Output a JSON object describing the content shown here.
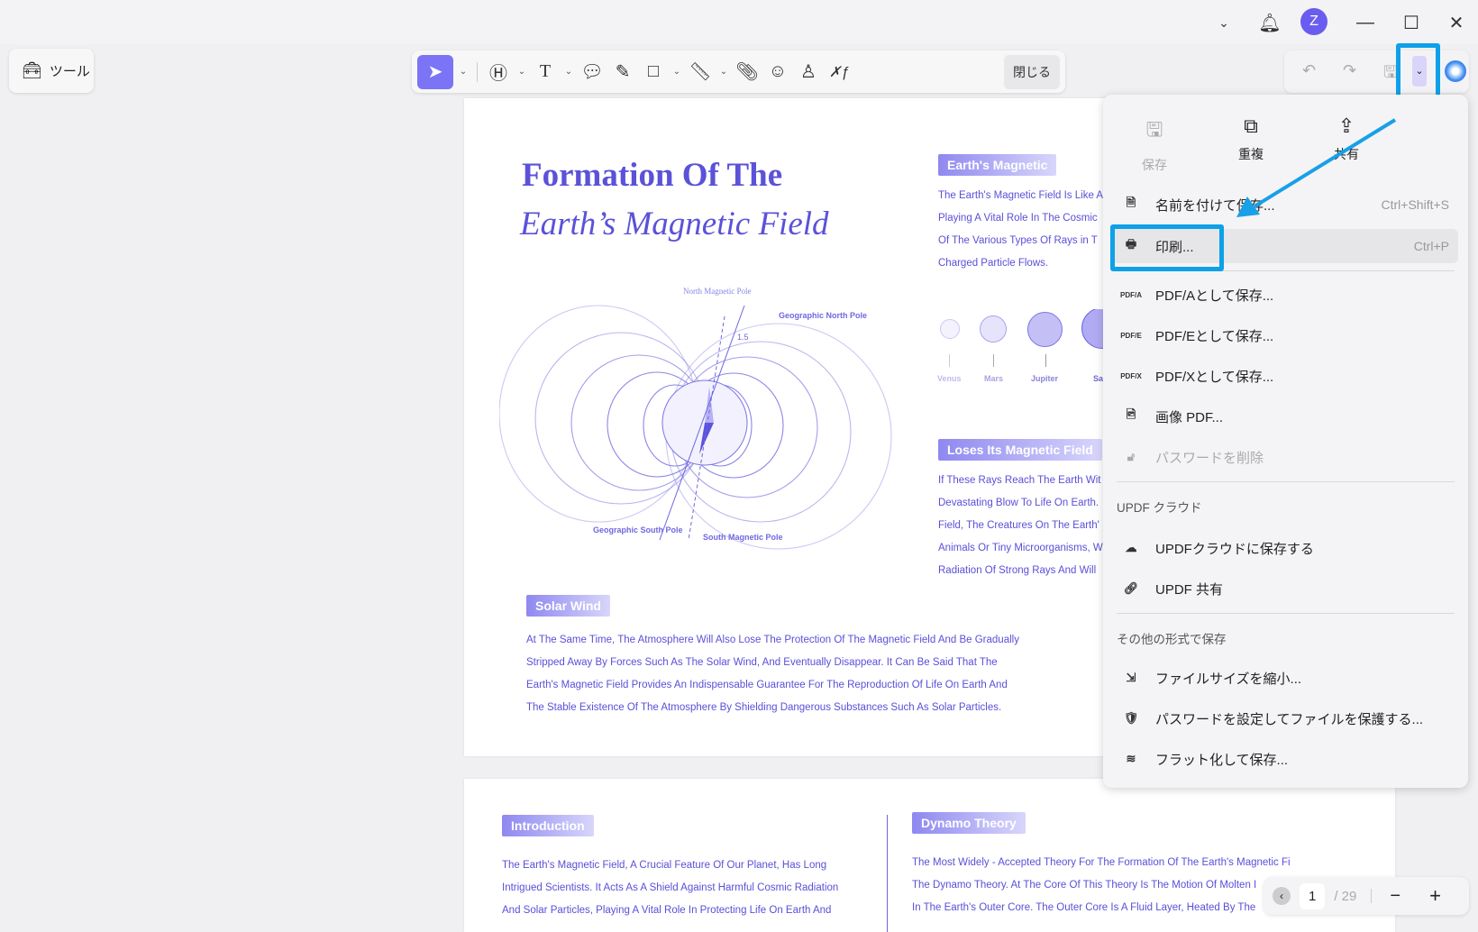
{
  "titlebar": {
    "avatar": "Z"
  },
  "tools_button": {
    "label": "ツール"
  },
  "toolbar": {
    "close_label": "閉じる"
  },
  "page1": {
    "title_line1": "Formation Of The",
    "title_line2": "Earth’s Magnetic Field",
    "diagram": {
      "north_magnetic": "North Magnetic Pole",
      "geo_north": "Geographic North Pole",
      "angle": "1.5",
      "geo_south": "Geographic South Pole",
      "south_magnetic": "South Magnetic Pole"
    },
    "earths_magnetic": {
      "heading": "Earth's Magnetic",
      "lines": [
        "The Earth's Magnetic Field Is Like A",
        "Playing A Vital Role In The Cosmic",
        "Of The Various Types Of Rays in T",
        "Charged Particle Flows."
      ]
    },
    "planets": [
      "Venus",
      "Mars",
      "Jupiter",
      "Sa"
    ],
    "loses": {
      "heading": "Loses Its Magnetic Field",
      "lines": [
        "If These Rays Reach The Earth Wit",
        "Devastating Blow To Life On Earth.",
        "Field, The Creatures On The Earth'",
        "Animals Or Tiny Microorganisms, W",
        "Radiation Of Strong Rays And Will"
      ]
    },
    "solar_wind": {
      "heading": "Solar Wind",
      "lines": [
        "At The Same Time, The Atmosphere Will Also Lose The Protection Of The Magnetic Field And Be Gradually",
        "Stripped Away By Forces Such As The Solar Wind, And Eventually Disappear. It Can Be Said That The",
        "Earth's Magnetic Field Provides An Indispensable Guarantee For The Reproduction Of Life On Earth And",
        "The Stable Existence Of The Atmosphere By Shielding Dangerous Substances Such As Solar Particles."
      ]
    }
  },
  "page2": {
    "intro": {
      "heading": "Introduction",
      "lines": [
        "The Earth's Magnetic Field, A Crucial Feature Of Our Planet, Has Long",
        "Intrigued Scientists. It Acts As A Shield Against Harmful Cosmic Radiation",
        "And Solar Particles, Playing A Vital Role In Protecting Life On Earth And"
      ]
    },
    "dynamo": {
      "heading": "Dynamo Theory",
      "lines": [
        "The Most Widely - Accepted Theory For The Formation Of The Earth's Magnetic Field Is",
        "The Dynamo Theory. At The Core Of This Theory Is The Motion Of Molten I",
        "In The Earth's Outer Core. The Outer Core Is A Fluid Layer, Heated By The"
      ]
    }
  },
  "menu": {
    "top": [
      {
        "label": "保存",
        "icon": "save-icon",
        "disabled": true
      },
      {
        "label": "重複",
        "icon": "duplicate-icon"
      },
      {
        "label": "共有",
        "icon": "share-icon"
      }
    ],
    "items": [
      {
        "label": "名前を付けて保存...",
        "shortcut": "Ctrl+Shift+S",
        "icon": "save-as-icon"
      },
      {
        "label": "印刷...",
        "shortcut": "Ctrl+P",
        "icon": "print-icon"
      },
      {
        "label": "PDF/Aとして保存...",
        "icon": "PDF/A"
      },
      {
        "label": "PDF/Eとして保存...",
        "icon": "PDF/E"
      },
      {
        "label": "PDF/Xとして保存...",
        "icon": "PDF/X"
      },
      {
        "label": "画像 PDF...",
        "icon": "image-pdf-icon"
      },
      {
        "label": "パスワードを削除",
        "icon": "remove-password-icon",
        "disabled": true
      }
    ],
    "cloud_header": "UPDF クラウド",
    "cloud_items": [
      {
        "label": "UPDFクラウドに保存する",
        "icon": "cloud-upload-icon"
      },
      {
        "label": "UPDF 共有",
        "icon": "link-icon"
      }
    ],
    "other_header": "その他の形式で保存",
    "other_items": [
      {
        "label": "ファイルサイズを縮小...",
        "icon": "compress-icon"
      },
      {
        "label": "パスワードを設定してファイルを保護する...",
        "icon": "protect-icon"
      },
      {
        "label": "フラット化して保存...",
        "icon": "flatten-icon"
      }
    ]
  },
  "pager": {
    "current": "1",
    "total": "/ 29"
  },
  "colors": {
    "accent": "#7b74f6",
    "highlight": "#0ea0e8",
    "doc_text": "#5a4fd8"
  }
}
